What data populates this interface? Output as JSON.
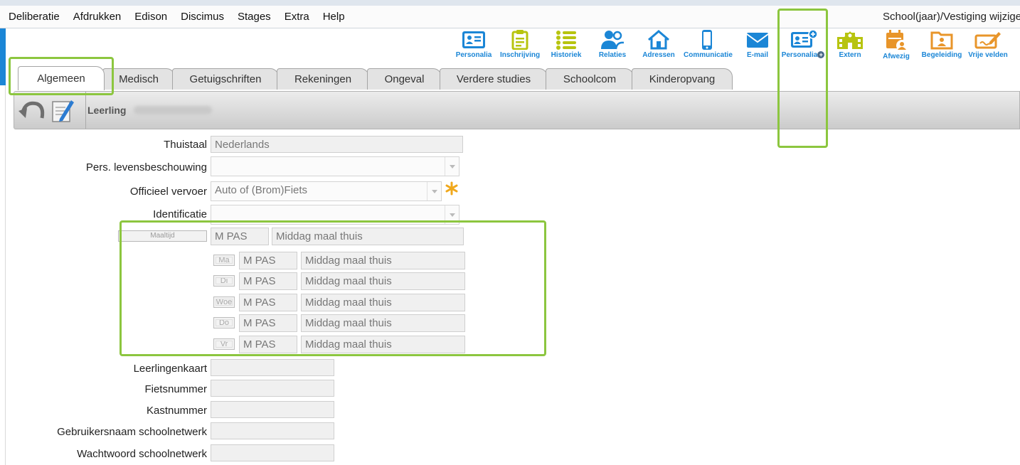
{
  "menu": {
    "items": [
      "Deliberatie",
      "Afdrukken",
      "Edison",
      "Discimus",
      "Stages",
      "Extra",
      "Help"
    ],
    "school_label": "School(jaar)/Vestiging wijzige"
  },
  "toolbar": {
    "personalia": "Personalia",
    "inschrijving": "Inschrijving",
    "historiek": "Historiek",
    "relaties": "Relaties",
    "adressen": "Adressen",
    "communicatie": "Communicatie",
    "email": "E-mail",
    "personalia_plus": "Personalia",
    "extern": "Extern",
    "afwezig": "Afwezig",
    "begeleiding": "Begeleiding",
    "vrije_velden": "Vrije velden"
  },
  "colors": {
    "accent_blue": "#1b86d6",
    "yellow_green": "#b7c40f",
    "orange": "#e8952a",
    "highlight": "#8cc63f"
  },
  "tabs": [
    "Algemeen",
    "Medisch",
    "Getuigschriften",
    "Rekeningen",
    "Ongeval",
    "Verdere studies",
    "Schoolcom",
    "Kinderopvang"
  ],
  "active_tab": "Algemeen",
  "header": {
    "leerling_label": "Leerling"
  },
  "form": {
    "thuistaal": {
      "label": "Thuistaal",
      "value": "Nederlands"
    },
    "levensbeschouwing": {
      "label": "Pers. levensbeschouwing",
      "value": ""
    },
    "vervoer": {
      "label": "Officieel vervoer",
      "value": "Auto of (Brom)Fiets"
    },
    "identificatie": {
      "label": "Identificatie",
      "value": ""
    },
    "maaltijd": {
      "button": "Maaltijd",
      "code": "M PAS",
      "description": "Middag maal thuis",
      "days": [
        {
          "day": "Ma",
          "code": "M PAS",
          "description": "Middag maal thuis"
        },
        {
          "day": "Di",
          "code": "M PAS",
          "description": "Middag maal thuis"
        },
        {
          "day": "Woe",
          "code": "M PAS",
          "description": "Middag maal thuis"
        },
        {
          "day": "Do",
          "code": "M PAS",
          "description": "Middag maal thuis"
        },
        {
          "day": "Vr",
          "code": "M PAS",
          "description": "Middag maal thuis"
        }
      ]
    },
    "leerlingenkaart": {
      "label": "Leerlingenkaart",
      "value": ""
    },
    "fietsnummer": {
      "label": "Fietsnummer",
      "value": ""
    },
    "kastnummer": {
      "label": "Kastnummer",
      "value": ""
    },
    "gebruikersnaam": {
      "label": "Gebruikersnaam schoolnetwerk",
      "value": ""
    },
    "wachtwoord": {
      "label": "Wachtwoord schoolnetwerk",
      "value": ""
    }
  }
}
